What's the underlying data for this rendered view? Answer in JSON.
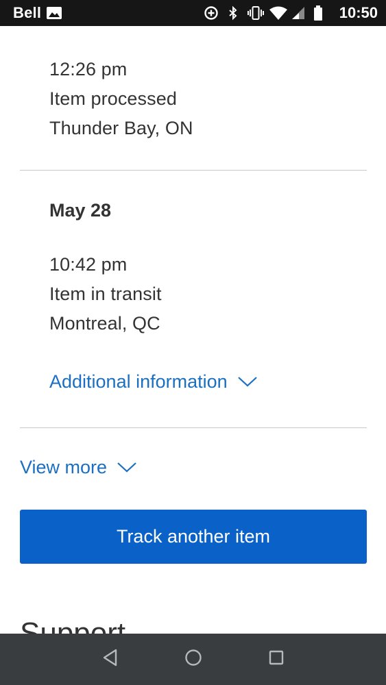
{
  "status_bar": {
    "carrier": "Bell",
    "time": "10:50",
    "icons": [
      "image-icon",
      "data-saver-icon",
      "bluetooth-icon",
      "vibrate-icon",
      "wifi-icon",
      "signal-icon",
      "battery-icon"
    ]
  },
  "timeline": {
    "first_event": {
      "time": "12:26 pm",
      "status": "Item processed",
      "location": "Thunder Bay, ON"
    },
    "group": {
      "date": "May 28",
      "event": {
        "time": "10:42 pm",
        "status": "Item in transit",
        "location": "Montreal, QC"
      },
      "additional_info_label": "Additional information"
    }
  },
  "view_more_label": "View more",
  "track_button_label": "Track another item",
  "support_heading": "Support",
  "colors": {
    "link": "#1b6fc2",
    "button": "#0a62c9",
    "text": "#333333",
    "status_bar": "#161616",
    "nav_bar": "#3a3d40"
  },
  "nav_bar": {
    "icons": [
      "back-icon",
      "home-icon",
      "recents-icon"
    ]
  }
}
